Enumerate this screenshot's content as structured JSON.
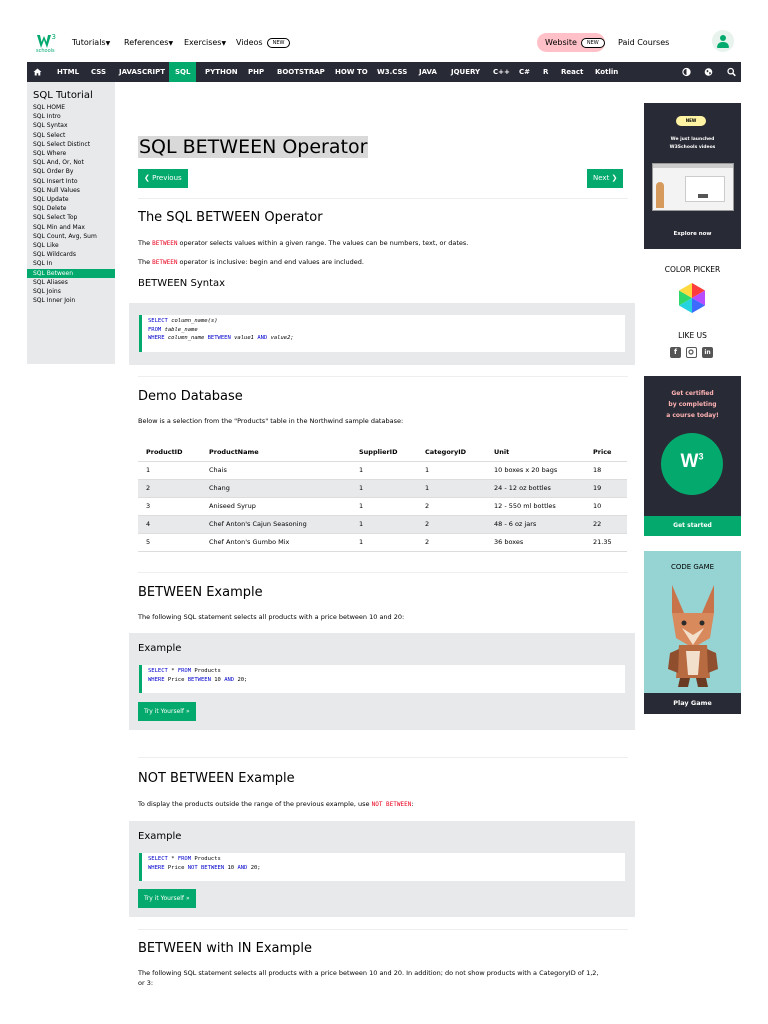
{
  "header": {
    "logo_text": "schools",
    "nav": [
      "Tutorials",
      "References",
      "Exercises",
      "Videos"
    ],
    "new_badge": "NEW",
    "website": "Website",
    "paid": "Paid Courses"
  },
  "topnav": [
    "HTML",
    "CSS",
    "JAVASCRIPT",
    "SQL",
    "PYTHON",
    "PHP",
    "BOOTSTRAP",
    "HOW TO",
    "W3.CSS",
    "JAVA",
    "JQUERY",
    "C++",
    "C#",
    "R",
    "React",
    "Kotlin"
  ],
  "sidebar": {
    "title": "SQL Tutorial",
    "items": [
      "SQL HOME",
      "SQL Intro",
      "SQL Syntax",
      "SQL Select",
      "SQL Select Distinct",
      "SQL Where",
      "SQL And, Or, Not",
      "SQL Order By",
      "SQL Insert Into",
      "SQL Null Values",
      "SQL Update",
      "SQL Delete",
      "SQL Select Top",
      "SQL Min and Max",
      "SQL Count, Avg, Sum",
      "SQL Like",
      "SQL Wildcards",
      "SQL In",
      "SQL Between",
      "SQL Aliases",
      "SQL Joins",
      "SQL Inner Join"
    ]
  },
  "main": {
    "title": "SQL BETWEEN Operator",
    "prev": "❮ Previous",
    "next": "Next ❯",
    "s1_heading": "The SQL BETWEEN Operator",
    "s1_p1_pre": "The",
    "s1_kw": "BETWEEN",
    "s1_p1_post": "operator selects values within a given range. The values can be numbers, text, or dates.",
    "s1_p2_pre": "The",
    "s1_p2_post": "operator is inclusive: begin and end values are included.",
    "syntax_heading": "BETWEEN Syntax",
    "syntax": {
      "l1_kw": "SELECT",
      "l1_rest": "column_name(s)",
      "l2_kw": "FROM",
      "l2_rest": "table_name",
      "l3_kw": "WHERE",
      "l3_col": "column_name",
      "l3_between": "BETWEEN",
      "l3_v1": "value1",
      "l3_and": "AND",
      "l3_v2": "value2;"
    },
    "demo_heading": "Demo Database",
    "demo_p": "Below is a selection from the \"Products\" table in the Northwind sample database:",
    "table": {
      "headers": [
        "ProductID",
        "ProductName",
        "SupplierID",
        "CategoryID",
        "Unit",
        "Price"
      ],
      "rows": [
        [
          "1",
          "Chais",
          "1",
          "1",
          "10 boxes x 20 bags",
          "18"
        ],
        [
          "2",
          "Chang",
          "1",
          "1",
          "24 - 12 oz bottles",
          "19"
        ],
        [
          "3",
          "Aniseed Syrup",
          "1",
          "2",
          "12 - 550 ml bottles",
          "10"
        ],
        [
          "4",
          "Chef Anton's Cajun Seasoning",
          "1",
          "2",
          "48 - 6 oz jars",
          "22"
        ],
        [
          "5",
          "Chef Anton's Gumbo Mix",
          "1",
          "2",
          "36 boxes",
          "21.35"
        ]
      ]
    },
    "ex1_heading": "BETWEEN Example",
    "ex1_p": "The following SQL statement selects all products with a price between 10 and 20:",
    "example_label": "Example",
    "ex1_code": {
      "l1_kw1": "SELECT",
      "l1_star": "*",
      "l1_kw2": "FROM",
      "l1_tbl": "Products",
      "l2_kw": "WHERE",
      "l2_col": "Price",
      "l2_between": "BETWEEN",
      "l2_v1": "10",
      "l2_and": "AND",
      "l2_v2": "20;"
    },
    "try_btn": "Try it Yourself »",
    "ex2_heading": "NOT BETWEEN Example",
    "ex2_p": "To display the products outside the range of the previous example, use",
    "ex2_kw": "NOT BETWEEN",
    "ex2_colon": ":",
    "ex2_code": {
      "l1_kw1": "SELECT",
      "l1_star": "*",
      "l1_kw2": "FROM",
      "l1_tbl": "Products",
      "l2_kw": "WHERE",
      "l2_col": "Price",
      "l2_not": "NOT BETWEEN",
      "l2_v1": "10",
      "l2_and": "AND",
      "l2_v2": "20;"
    },
    "ex3_heading": "BETWEEN with IN Example",
    "ex3_p1": "The following SQL statement selects all products with a price between 10 and 20. In addition; do not show products with a CategoryID of 1,2,",
    "ex3_p2": "or 3:"
  },
  "right": {
    "ad1_new": "NEW",
    "ad1_line1": "We just launched",
    "ad1_line2": "W3Schools videos",
    "ad1_link": "Explore now",
    "color_picker": "COLOR PICKER",
    "like_us": "LIKE US",
    "ad2_line1": "Get certified",
    "ad2_line2": "by completing",
    "ad2_line3": "a course today!",
    "ad2_cta": "Get started",
    "ad3_title": "CODE GAME",
    "ad3_cta": "Play Game"
  },
  "colors": {
    "brand": "#04AA6D",
    "dark": "#282A35",
    "panel": "#E7E9EB"
  }
}
